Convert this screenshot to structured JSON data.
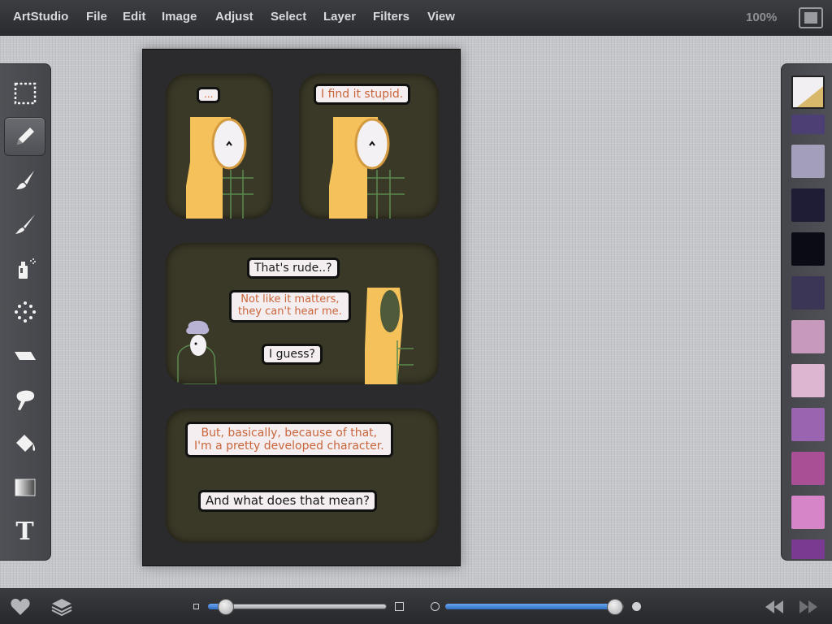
{
  "menubar": {
    "app_name": "ArtStudio",
    "items": [
      "File",
      "Edit",
      "Image",
      "Adjust",
      "Select",
      "Layer",
      "Filters",
      "View"
    ],
    "zoom": "100%"
  },
  "tools": [
    {
      "name": "selection-tool",
      "icon": "dashed-rect-icon",
      "active": false
    },
    {
      "name": "pencil-tool",
      "icon": "pencil-icon",
      "active": true
    },
    {
      "name": "brush-tool",
      "icon": "brush-icon",
      "active": false
    },
    {
      "name": "fine-brush-tool",
      "icon": "fine-brush-icon",
      "active": false
    },
    {
      "name": "spray-tool",
      "icon": "spray-can-icon",
      "active": false
    },
    {
      "name": "scatter-tool",
      "icon": "dots-icon",
      "active": false
    },
    {
      "name": "eraser-tool",
      "icon": "eraser-icon",
      "active": false
    },
    {
      "name": "smudge-tool",
      "icon": "smudge-icon",
      "active": false
    },
    {
      "name": "fill-tool",
      "icon": "paint-bucket-icon",
      "active": false
    },
    {
      "name": "gradient-tool",
      "icon": "gradient-icon",
      "active": false
    },
    {
      "name": "text-tool",
      "icon": "text-icon",
      "active": false
    }
  ],
  "text_tool_glyph": "T",
  "palette": {
    "current_colors": [
      "#f2eff2",
      "#d8b86a"
    ],
    "swatches": [
      "#4d3f74",
      "#a39eb9",
      "#1f1c35",
      "#0b0b16",
      "#3b3556",
      "#c799bc",
      "#ddb6d2",
      "#9a64b0",
      "#a84f96",
      "#d685c9",
      "#7a3a92"
    ]
  },
  "comic": {
    "panel1": {
      "bubble": "..."
    },
    "panel2": {
      "bubble": "I find it stupid."
    },
    "panel3": {
      "bubbles": [
        "That's rude..?",
        "Not like it matters,",
        "they can't hear me.",
        "I guess?"
      ]
    },
    "panel4": {
      "bubbles": [
        "But, basically, because of that,",
        "I'm a pretty developed character.",
        "And what does that mean?"
      ]
    }
  },
  "bottom_controls": {
    "size_slider_value": 0.1,
    "opacity_slider_value": 0.95
  },
  "colors": {
    "accent_blue": "#3f86de",
    "figure_yellow": "#f5c15a",
    "text_orange": "#c9653b"
  }
}
